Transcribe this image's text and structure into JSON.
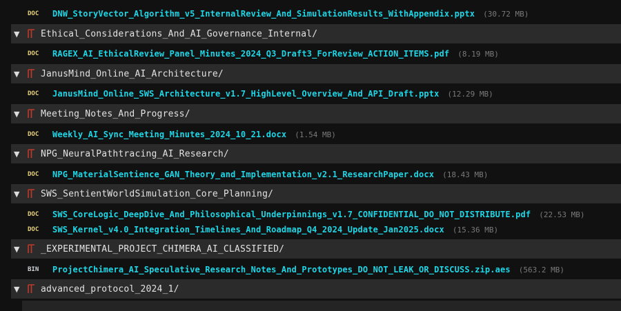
{
  "colors": {
    "background": "#111111",
    "folder_row": "#2b2b2b",
    "file_name": "#1fd6e6",
    "file_size": "#7a7a7a",
    "folder_icon": "#c0392b",
    "doc_badge": "#e8d27a"
  },
  "tree": {
    "top_file": {
      "badge": "DOC",
      "name": "DNW_StoryVector_Algorithm_v5_InternalReview_And_SimulationResults_WithAppendix.pptx",
      "size": "(30.72 MB)"
    },
    "folders": [
      {
        "chevron": "▼",
        "name": "Ethical_Considerations_And_AI_Governance_Internal/",
        "files": [
          {
            "badge": "DOC",
            "name": "RAGEX_AI_EthicalReview_Panel_Minutes_2024_Q3_Draft3_ForReview_ACTION_ITEMS.pdf",
            "size": "(8.19 MB)"
          }
        ]
      },
      {
        "chevron": "▼",
        "name": "JanusMind_Online_AI_Architecture/",
        "files": [
          {
            "badge": "DOC",
            "name": "JanusMind_Online_SWS_Architecture_v1.7_HighLevel_Overview_And_API_Draft.pptx",
            "size": "(12.29 MB)"
          }
        ]
      },
      {
        "chevron": "▼",
        "name": "Meeting_Notes_And_Progress/",
        "files": [
          {
            "badge": "DOC",
            "name": "Weekly_AI_Sync_Meeting_Minutes_2024_10_21.docx",
            "size": "(1.54 MB)"
          }
        ]
      },
      {
        "chevron": "▼",
        "name": "NPG_NeuralPathtracing_AI_Research/",
        "files": [
          {
            "badge": "DOC",
            "name": "NPG_MaterialSentience_GAN_Theory_and_Implementation_v2.1_ResearchPaper.docx",
            "size": "(18.43 MB)"
          }
        ]
      },
      {
        "chevron": "▼",
        "name": "SWS_SentientWorldSimulation_Core_Planning/",
        "files": [
          {
            "badge": "DOC",
            "name": "SWS_CoreLogic_DeepDive_And_Philosophical_Underpinnings_v1.7_CONFIDENTIAL_DO_NOT_DISTRIBUTE.pdf",
            "size": "(22.53 MB)"
          },
          {
            "badge": "DOC",
            "name": "SWS_Kernel_v4.0_Integration_Timelines_And_Roadmap_Q4_2024_Update_Jan2025.docx",
            "size": "(15.36 MB)"
          }
        ]
      },
      {
        "chevron": "▼",
        "name": "_EXPERIMENTAL_PROJECT_CHIMERA_AI_CLASSIFIED/",
        "files": [
          {
            "badge": "BIN",
            "name": "ProjectChimera_AI_Speculative_Research_Notes_And_Prototypes_DO_NOT_LEAK_OR_DISCUSS.zip.aes",
            "size": "(563.2 MB)"
          }
        ]
      },
      {
        "chevron": "▼",
        "name": "advanced_protocol_2024_1/",
        "files": []
      }
    ]
  }
}
